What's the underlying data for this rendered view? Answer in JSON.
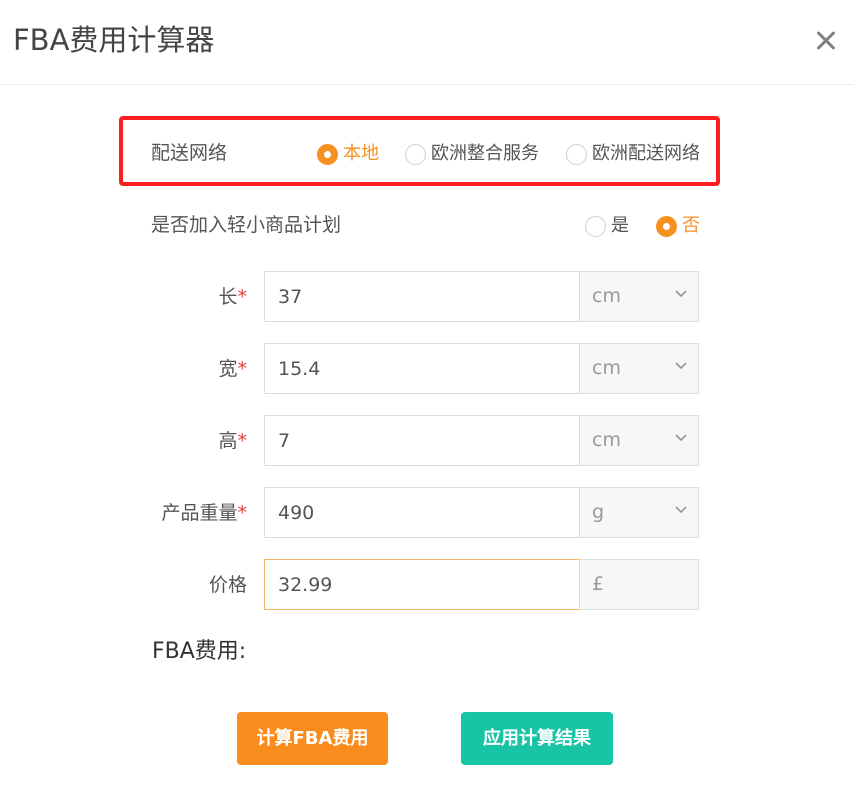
{
  "dialog": {
    "title": "FBA费用计算器"
  },
  "network": {
    "label": "配送网络",
    "options": [
      "本地",
      "欧洲整合服务",
      "欧洲配送网络"
    ],
    "selected": "本地",
    "highlight_color": "#ff1e1e"
  },
  "small_light": {
    "label": "是否加入轻小商品计划",
    "options": [
      "是",
      "否"
    ],
    "selected": "否"
  },
  "fields": {
    "length": {
      "label": "长",
      "required_mark": "*",
      "value": "37",
      "unit": "cm"
    },
    "width": {
      "label": "宽",
      "required_mark": "*",
      "value": "15.4",
      "unit": "cm"
    },
    "height": {
      "label": "高",
      "required_mark": "*",
      "value": "7",
      "unit": "cm"
    },
    "weight": {
      "label": "产品重量",
      "required_mark": "*",
      "value": "490",
      "unit": "g"
    },
    "price": {
      "label": "价格",
      "value": "32.99",
      "unit": "£"
    }
  },
  "result": {
    "label": "FBA费用:"
  },
  "buttons": {
    "calculate": "计算FBA费用",
    "apply": "应用计算结果"
  },
  "colors": {
    "accent_orange": "#fa8c1e",
    "radio_orange": "#f59121",
    "accent_teal": "#17c5a4",
    "required_red": "#e23b3b"
  },
  "icons": {
    "close": "close-icon",
    "dropdown": "chevron-down-icon"
  }
}
